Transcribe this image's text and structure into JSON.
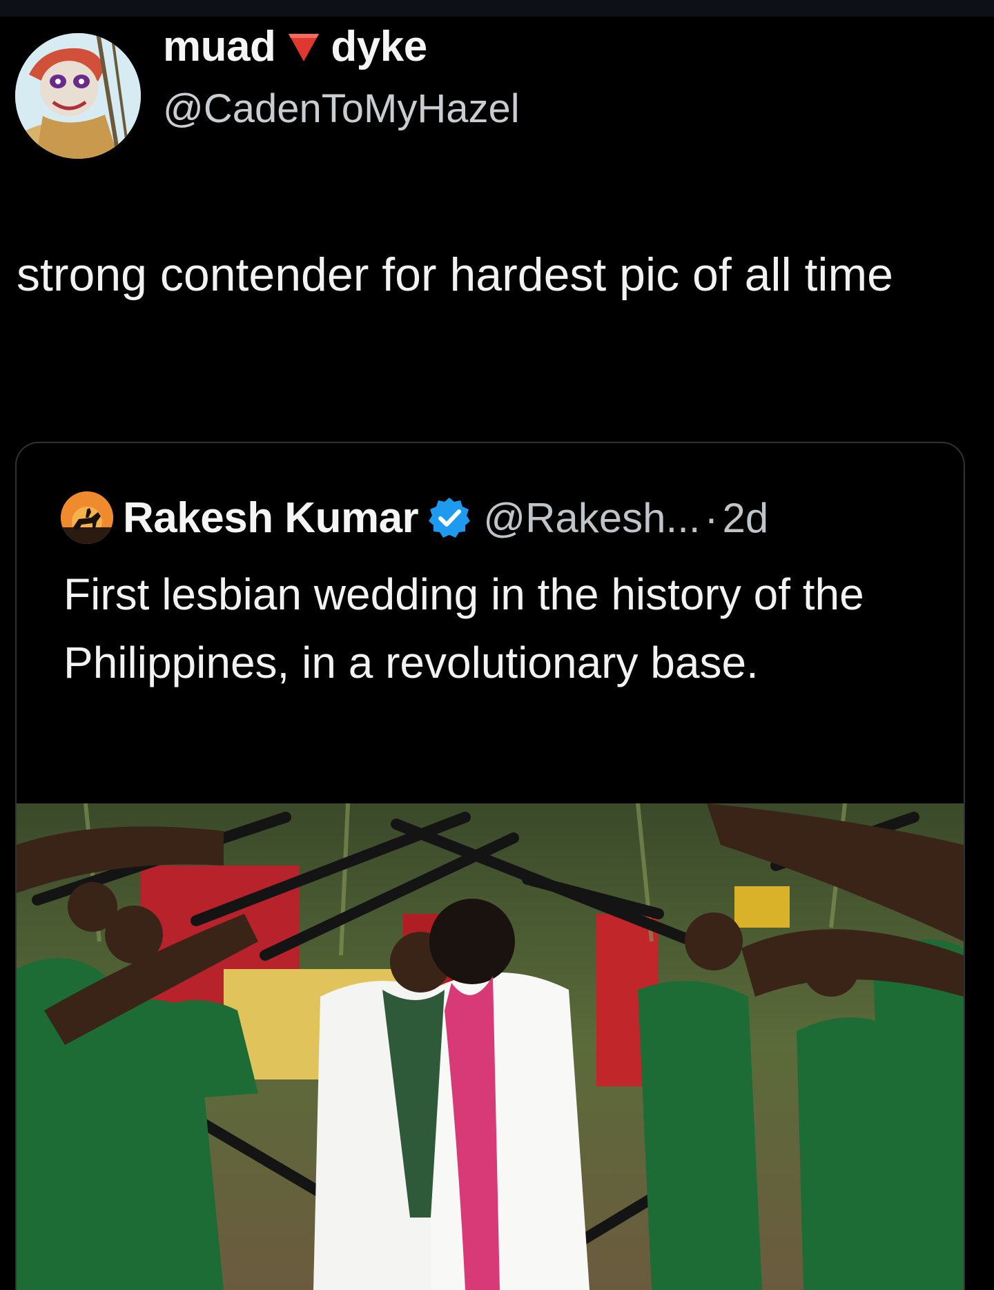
{
  "author": {
    "name_part1": "muad",
    "name_emoji": "red-triangle-down",
    "name_part2": "dyke",
    "handle": "@CadenToMyHazel",
    "avatar_icon": "cartoon-character-avatar"
  },
  "tweet": {
    "text": "strong contender for hardest pic of all time"
  },
  "quoted_tweet": {
    "name": "Rakesh Kumar",
    "verified_icon": "verified-badge-icon",
    "handle": "@Rakesh...",
    "separator": "·",
    "timestamp": "2d",
    "text": "First lesbian wedding in the history of the Philippines, in a revolutionary base.",
    "avatar_icon": "horse-rider-sunset-avatar",
    "photo_icon": "wedding-under-rifle-arch-photo"
  },
  "colors": {
    "background": "#000000",
    "verified": "#1d9bf0",
    "emoji_red": "#e0382f"
  }
}
